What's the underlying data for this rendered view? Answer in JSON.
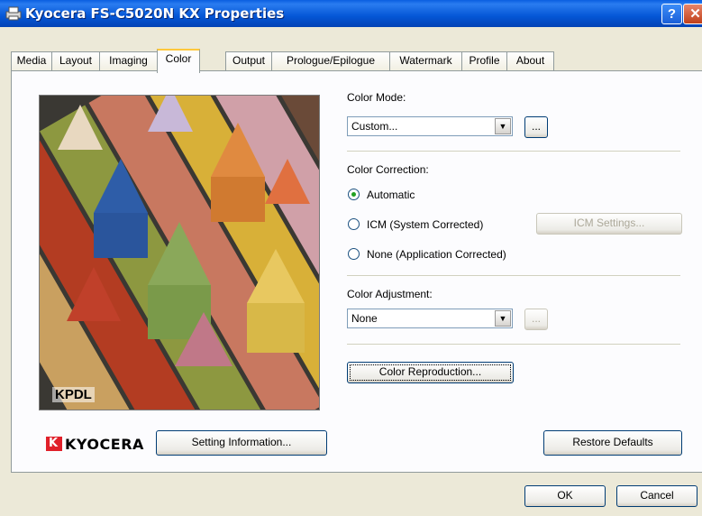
{
  "window": {
    "title": "Kyocera FS-C5020N KX Properties",
    "help_label": "?",
    "close_label": "✕"
  },
  "tabs": [
    {
      "label": "Media"
    },
    {
      "label": "Layout"
    },
    {
      "label": "Imaging"
    },
    {
      "label": "Color",
      "active": true
    },
    {
      "label": "Output"
    },
    {
      "label": "Prologue/Epilogue"
    },
    {
      "label": "Watermark"
    },
    {
      "label": "Profile"
    },
    {
      "label": "About"
    }
  ],
  "preview": {
    "caption": "KPDL"
  },
  "color_mode": {
    "label": "Color Mode:",
    "value": "Custom...",
    "more_label": "..."
  },
  "color_correction": {
    "label": "Color Correction:",
    "options": [
      {
        "label": "Automatic",
        "selected": true
      },
      {
        "label": "ICM (System Corrected)",
        "selected": false
      },
      {
        "label": "None (Application Corrected)",
        "selected": false
      }
    ],
    "icm_settings_label": "ICM Settings..."
  },
  "color_adjustment": {
    "label": "Color Adjustment:",
    "value": "None",
    "more_label": "..."
  },
  "color_reproduction_label": "Color Reproduction...",
  "brand": {
    "logo_text": "KYOCERA"
  },
  "setting_information_label": "Setting Information...",
  "restore_defaults_label": "Restore Defaults",
  "footer": {
    "ok_label": "OK",
    "cancel_label": "Cancel"
  },
  "colors": {
    "title_bar": "#0456d6",
    "tab_highlight": "#ffc83c",
    "radio_selected": "#21a121",
    "logo_red": "#e0202a"
  }
}
